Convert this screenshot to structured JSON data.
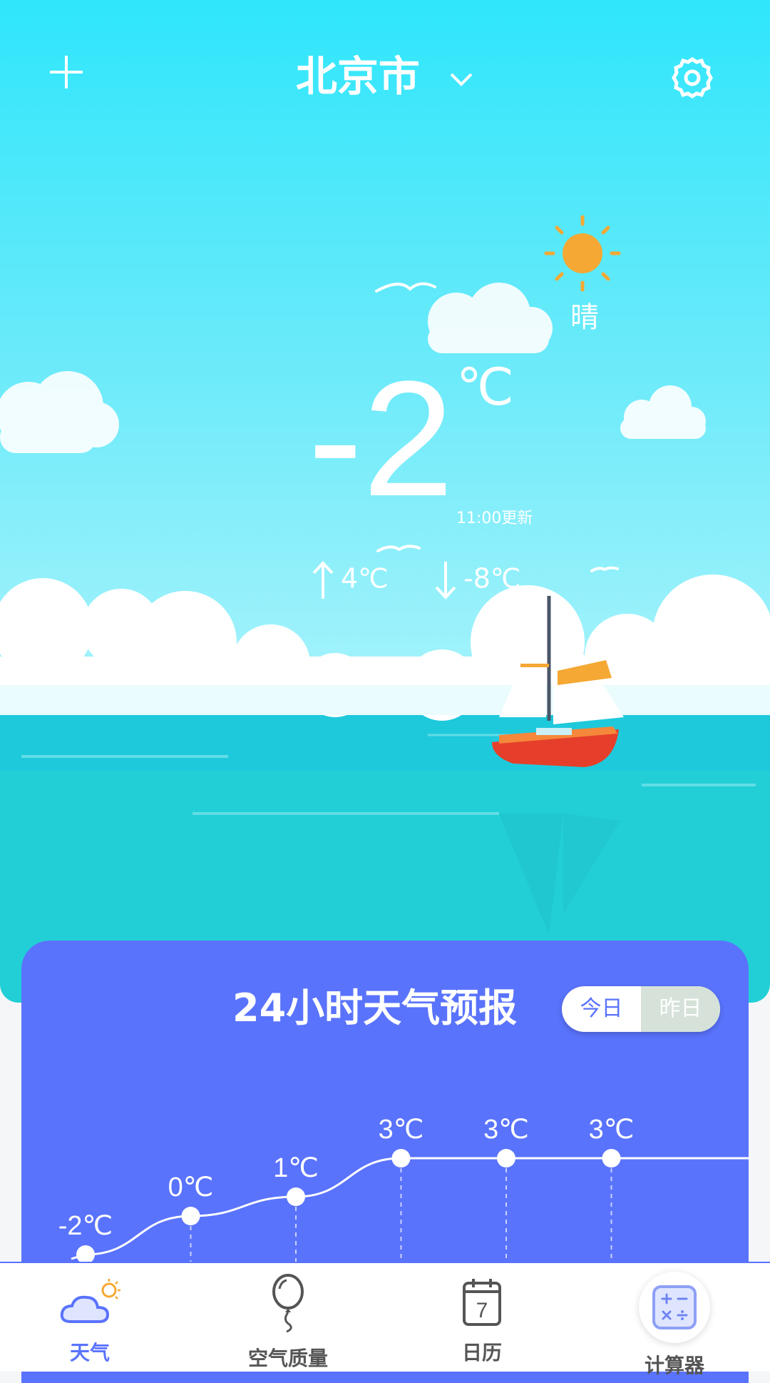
{
  "header": {
    "city": "北京市"
  },
  "weather": {
    "condition": "晴",
    "temperature": "-2",
    "unit": "℃",
    "update_time": "11:00更新",
    "high": "4℃",
    "low": "-8℃"
  },
  "forecast": {
    "title": "24小时天气预报",
    "toggle_today": "今日",
    "toggle_yesterday": "昨日"
  },
  "chart_data": {
    "type": "line",
    "x": [
      "",
      "",
      "",
      "",
      "",
      ""
    ],
    "values": [
      -2,
      0,
      1,
      3,
      3,
      3
    ],
    "labels": [
      "-2℃",
      "0℃",
      "1℃",
      "3℃",
      "3℃",
      "3℃"
    ]
  },
  "nav": {
    "items": [
      {
        "label": "天气",
        "icon": "weather-icon"
      },
      {
        "label": "空气质量",
        "icon": "balloon-icon"
      },
      {
        "label": "日历",
        "icon": "calendar-icon",
        "day": "7"
      },
      {
        "label": "计算器",
        "icon": "calculator-icon"
      }
    ]
  },
  "colors": {
    "accent": "#5a73fc",
    "sun": "#f5a833",
    "sky": "#2fe6fb",
    "sea": "#22cfd6"
  }
}
